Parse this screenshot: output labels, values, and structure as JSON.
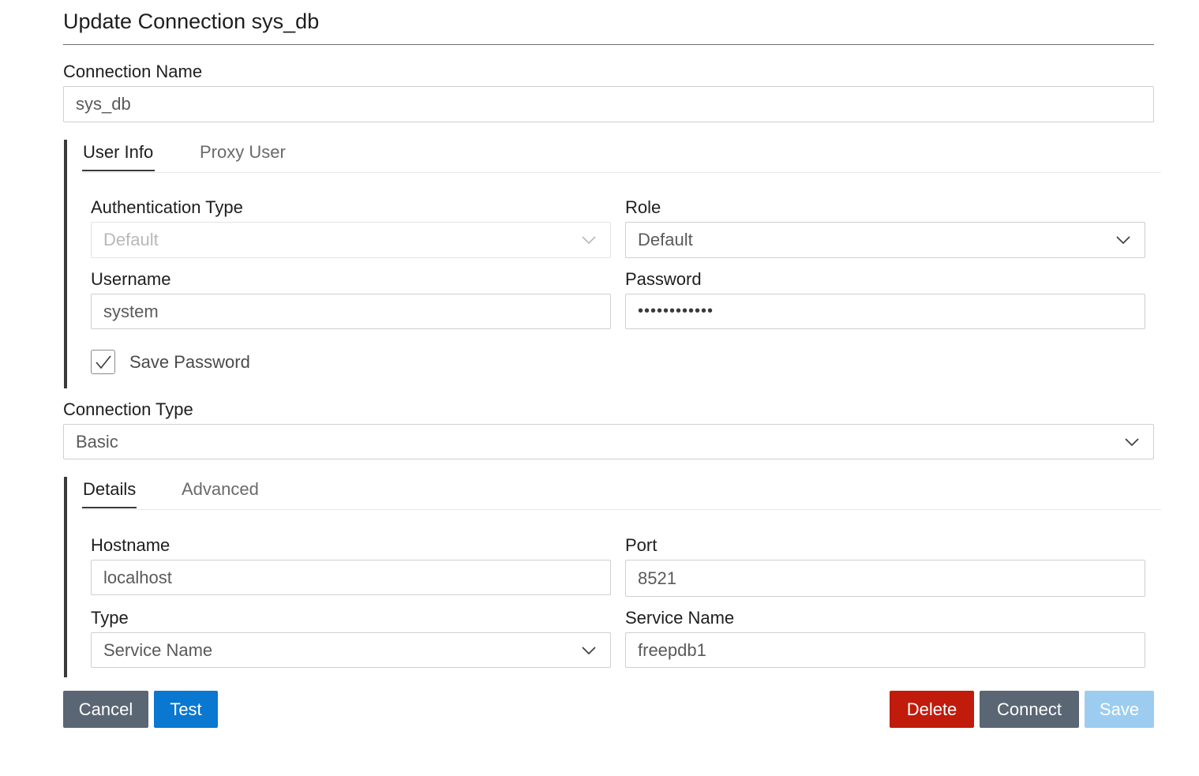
{
  "dialog": {
    "title": "Update Connection sys_db"
  },
  "connection_name": {
    "label": "Connection Name",
    "value": "sys_db"
  },
  "user_tabs": {
    "tabs": [
      "User Info",
      "Proxy User"
    ],
    "active": "User Info"
  },
  "user_info": {
    "auth_type_label": "Authentication Type",
    "auth_type_value": "Default",
    "role_label": "Role",
    "role_value": "Default",
    "username_label": "Username",
    "username_value": "system",
    "password_label": "Password",
    "password_value": "••••••••••••",
    "save_password_label": "Save Password",
    "save_password_checked": true
  },
  "connection_type": {
    "label": "Connection Type",
    "value": "Basic"
  },
  "detail_tabs": {
    "tabs": [
      "Details",
      "Advanced"
    ],
    "active": "Details"
  },
  "details": {
    "hostname_label": "Hostname",
    "hostname_value": "localhost",
    "port_label": "Port",
    "port_value": "8521",
    "type_label": "Type",
    "type_value": "Service Name",
    "service_name_label": "Service Name",
    "service_name_value": "freepdb1"
  },
  "buttons": {
    "cancel": "Cancel",
    "test": "Test",
    "delete": "Delete",
    "connect": "Connect",
    "save": "Save"
  },
  "colors": {
    "cancel": "#5a6673",
    "test": "#0a77d0",
    "delete": "#c01b0b",
    "connect": "#5a6673",
    "save_disabled": "#9ccdf0"
  },
  "icons": {
    "dropdown": "chevron-down-icon",
    "checkbox": "check-icon"
  }
}
